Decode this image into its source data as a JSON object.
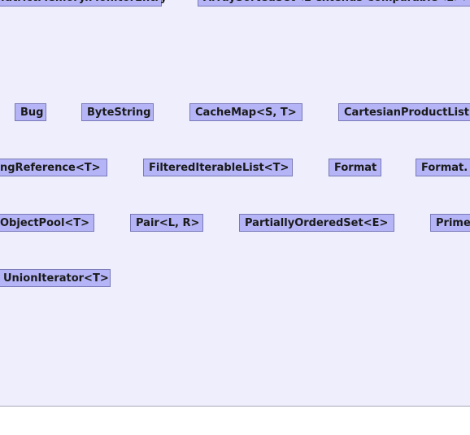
{
  "diagram": {
    "rows": [
      {
        "nodes": [
          {
            "id": "monitor-entry",
            "label": "...utrictMemory.MonitorEntry"
          },
          {
            "id": "array-sorted-set",
            "label": "ArraySortedSet<E extends Comparable<E>>"
          }
        ]
      },
      {
        "nodes": [
          {
            "id": "bug",
            "label": "Bug"
          },
          {
            "id": "byte-string",
            "label": "ByteString"
          },
          {
            "id": "cache-map",
            "label": "CacheMap<S, T>"
          },
          {
            "id": "cartesian-product-list",
            "label": "CartesianProductList"
          }
        ]
      },
      {
        "nodes": [
          {
            "id": "caching-reference",
            "label": "ngReference<T>"
          },
          {
            "id": "filtered-iterable-list",
            "label": "FilteredIterableList<T>"
          },
          {
            "id": "format",
            "label": "Format"
          },
          {
            "id": "format-inner",
            "label": "Format."
          }
        ]
      },
      {
        "nodes": [
          {
            "id": "object-pool",
            "label": "ObjectPool<T>"
          },
          {
            "id": "pair",
            "label": "Pair<L, R>"
          },
          {
            "id": "partially-ordered-set",
            "label": "PartiallyOrderedSet<E>"
          },
          {
            "id": "prime",
            "label": "Prime"
          }
        ]
      },
      {
        "nodes": [
          {
            "id": "union-iterator",
            "label": "UnionIterator<T>"
          }
        ]
      }
    ]
  }
}
